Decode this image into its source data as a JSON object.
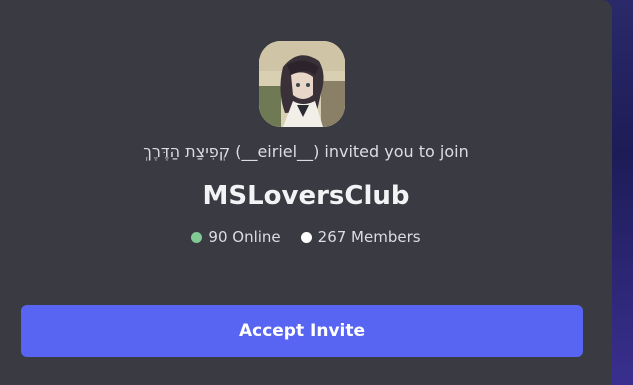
{
  "invite": {
    "inviter_display": "קְפִיצַת הַדֶּרֶךְ",
    "inviter_username": "__eiriel__",
    "invited_text": "invited you to join",
    "server_name": "MSLoversClub",
    "online_count_label": "90 Online",
    "member_count_label": "267 Members",
    "accept_label": "Accept Invite"
  },
  "colors": {
    "online_dot": "#81c995",
    "members_dot": "#ffffff",
    "accent": "#5865f2",
    "card_bg": "#393a42"
  },
  "icons": {
    "server_avatar": "anime-character-avatar"
  }
}
